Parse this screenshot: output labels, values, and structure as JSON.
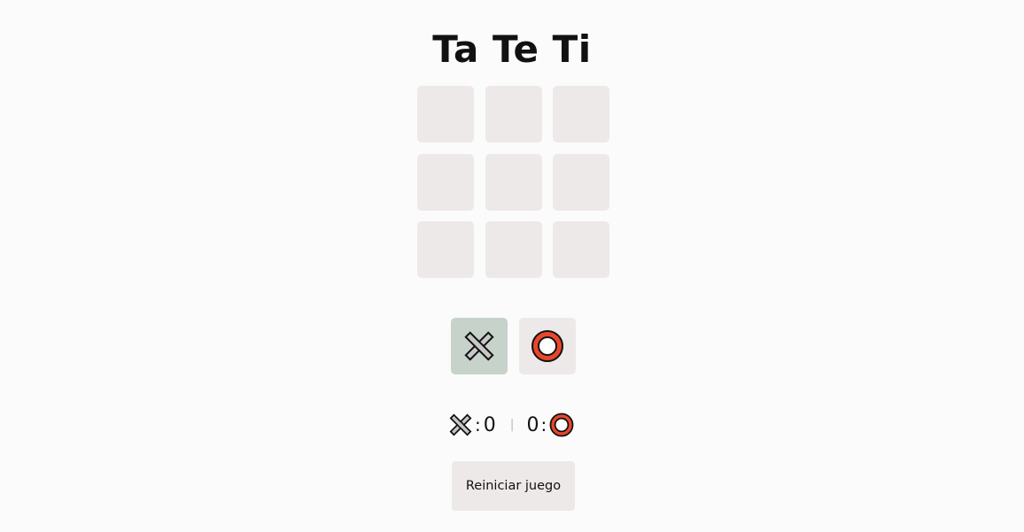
{
  "title": "Ta Te Ti",
  "board": {
    "cells": [
      "",
      "",
      "",
      "",
      "",
      "",
      "",
      "",
      ""
    ]
  },
  "turn": {
    "current": "x",
    "x_icon": "x-mark-icon",
    "o_icon": "o-ring-icon"
  },
  "score": {
    "x": "0",
    "o": "0",
    "x_separator": ":",
    "o_separator": ":",
    "divider": "|"
  },
  "reset_label": "Reiniciar juego",
  "colors": {
    "background": "#fbfbfb",
    "cell": "#ede9e8",
    "active_turn": "#c6d2ca",
    "x_fill": "#c7c7c7",
    "o_fill": "#e8472a"
  }
}
